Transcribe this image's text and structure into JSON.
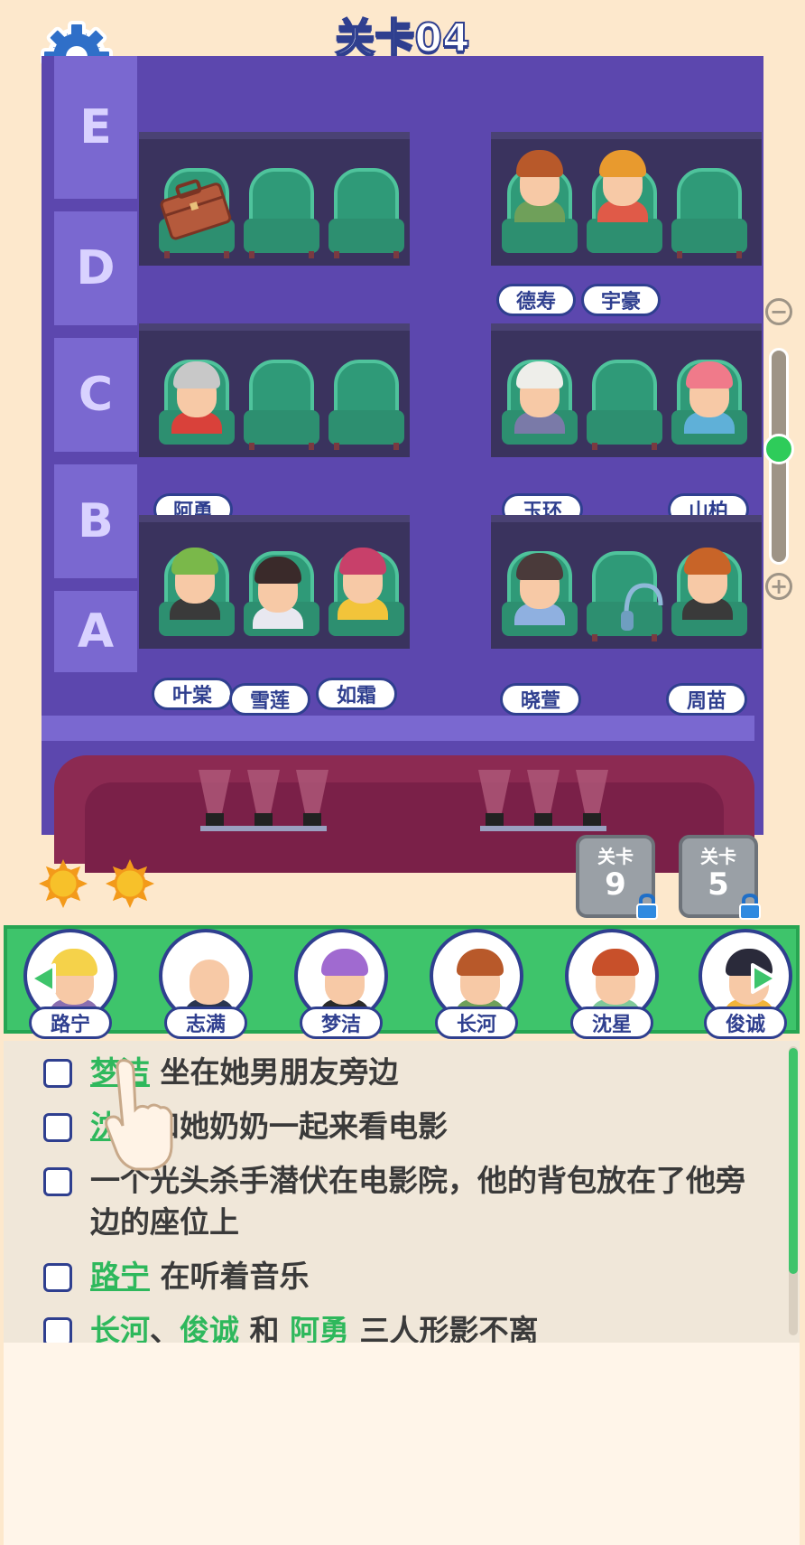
{
  "level_title": "关卡04",
  "rows": [
    "E",
    "D",
    "C",
    "B",
    "A"
  ],
  "seated": {
    "E_right_1": "德寿",
    "E_right_2": "宇豪",
    "C_left_1": "阿勇",
    "C_right_1": "玉环",
    "C_right_3": "山柏",
    "B_left_1": "叶棠",
    "B_left_2": "雪莲",
    "B_left_3": "如霜",
    "B_right_1": "晓萱",
    "B_right_3": "周苗"
  },
  "locked_levels": [
    {
      "label": "关卡",
      "number": "9"
    },
    {
      "label": "关卡",
      "number": "5"
    }
  ],
  "suns_count": 2,
  "characters": [
    "路宁",
    "志满",
    "梦洁",
    "长河",
    "沈星",
    "俊诚"
  ],
  "clues": [
    {
      "name": "梦洁",
      "text": "坐在她男朋友旁边"
    },
    {
      "name": "沈星",
      "text": "和她奶奶一起来看电影"
    },
    {
      "name": "",
      "text": "一个光头杀手潜伏在电影院，他的背包放在了他旁边的座位上"
    },
    {
      "name": "路宁",
      "text": "在听着音乐"
    },
    {
      "name": "长河",
      "name2": "俊诚",
      "sep": "、",
      "and": "和",
      "name3": "阿勇",
      "text": "三人形影不离"
    }
  ],
  "colors": {
    "accent_green": "#3ec46b",
    "hall_purple": "#5c47ae",
    "outline_navy": "#2f3f8f"
  }
}
